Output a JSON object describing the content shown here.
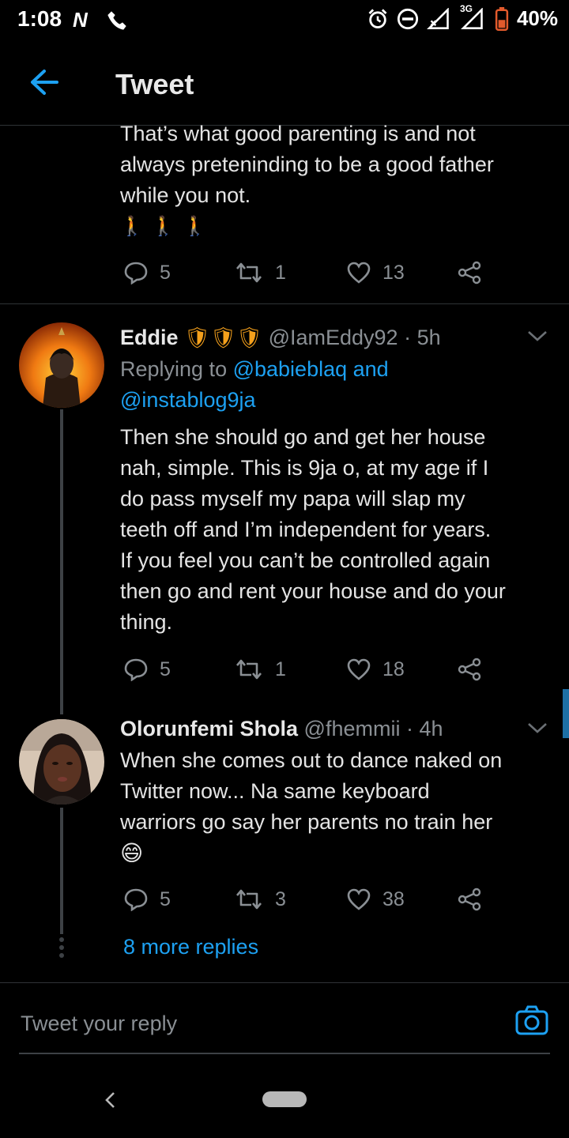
{
  "status": {
    "time": "1:08",
    "network": "3G",
    "battery": "40%"
  },
  "header": {
    "title": "Tweet"
  },
  "top_tweet": {
    "lines": [
      "That’s what good parenting is and not",
      "always preteninding to be a good father",
      "while you not."
    ],
    "emoji": "🚶🚶🚶",
    "replies": "5",
    "retweets": "1",
    "likes": "13"
  },
  "tweets": [
    {
      "name": "Eddie",
      "badges": "🛡🛡🛡",
      "handle": "@IamEddy92 · 5h",
      "replying_prefix": "Replying to ",
      "replying_users": "@babieblaq and",
      "replying_users2": "@instablog9ja",
      "lines": [
        "Then she should go and get her house",
        "nah, simple. This is 9ja o, at my age if I",
        "do pass myself my papa will slap my",
        "teeth off and I’m independent for years.",
        "If you feel you can’t be controlled again",
        "then go and rent your house and do your",
        "thing."
      ],
      "replies": "5",
      "retweets": "1",
      "likes": "18"
    },
    {
      "name": "Olorunfemi Shola",
      "handle": "@fhemmii · 4h",
      "lines": [
        "When she comes out to dance naked on",
        "Twitter now... Na same keyboard",
        "warriors go say her parents no train her"
      ],
      "emoji": "😄",
      "replies": "5",
      "retweets": "3",
      "likes": "38"
    }
  ],
  "more_replies": "8 more replies",
  "reply_box": {
    "placeholder": "Tweet your reply"
  },
  "colors": {
    "accent": "#1da1f2",
    "background": "#000000",
    "muted": "#8a8f94",
    "divider": "#2f3336"
  },
  "icons": [
    "back-arrow-icon",
    "reply-icon",
    "retweet-icon",
    "like-icon",
    "share-icon",
    "camera-icon",
    "chevron-down-icon"
  ]
}
